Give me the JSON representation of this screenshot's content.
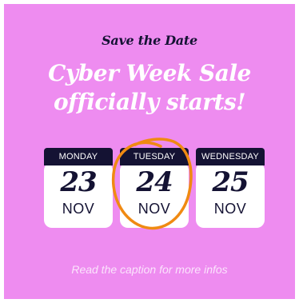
{
  "eyebrow": "Save the Date",
  "headline": {
    "line1": "Cyber Week Sale",
    "line2": "officially starts!"
  },
  "dates": [
    {
      "day": "MONDAY",
      "number": "23",
      "month": "NOV"
    },
    {
      "day": "TUESDAY",
      "number": "24",
      "month": "NOV"
    },
    {
      "day": "WEDNESDAY",
      "number": "25",
      "month": "NOV"
    }
  ],
  "caption": "Read the caption for more infos",
  "colors": {
    "background": "#ee8cf0",
    "dark": "#141233",
    "highlight_circle": "#f08a12"
  },
  "highlighted_date": "24"
}
